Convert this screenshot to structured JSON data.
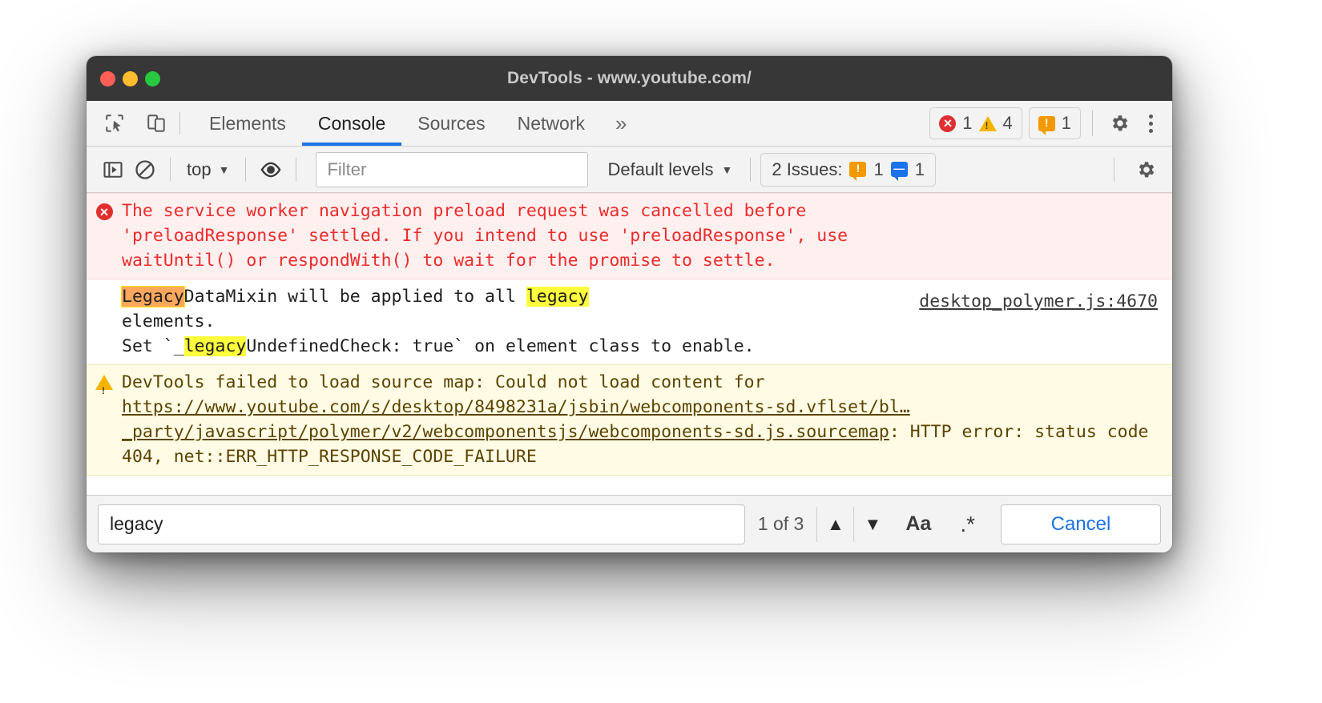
{
  "window": {
    "title": "DevTools - www.youtube.com/",
    "traffic_lights": [
      "close",
      "minimize",
      "maximize"
    ]
  },
  "tabstrip": {
    "inspect_icon": "inspect-element-icon",
    "device_icon": "device-toolbar-icon",
    "tabs": [
      {
        "label": "Elements",
        "active": false
      },
      {
        "label": "Console",
        "active": true
      },
      {
        "label": "Sources",
        "active": false
      },
      {
        "label": "Network",
        "active": false
      }
    ],
    "more_tabs": "»",
    "counters": {
      "error_count": "1",
      "warning_count": "4",
      "issue_count": "1"
    },
    "settings_icon": "gear-icon",
    "menu_icon": "kebab-menu-icon"
  },
  "console_toolbar": {
    "sidebar_icon": "console-sidebar-icon",
    "clear_icon": "clear-console-icon",
    "context": "top",
    "context_caret": "▼",
    "eye_icon": "live-expression-icon",
    "filter_placeholder": "Filter",
    "filter_value": "",
    "levels_label": "Default levels",
    "levels_caret": "▼",
    "issues_label": "2 Issues:",
    "issues_warning_count": "1",
    "issues_info_count": "1",
    "settings_icon": "console-settings-gear-icon"
  },
  "messages": [
    {
      "type": "error",
      "icon": "error-circle-icon",
      "lines": [
        "The service worker navigation preload request was cancelled before",
        "'preloadResponse' settled. If you intend to use 'preloadResponse', use",
        "waitUntil() or respondWith() to wait for the promise to settle."
      ]
    },
    {
      "type": "plain",
      "icon": "",
      "segments": [
        {
          "text": "Legacy",
          "highlight": "active"
        },
        {
          "text": "DataMixin will be applied to all ",
          "highlight": "none"
        },
        {
          "text": "legacy",
          "highlight": "yellow"
        },
        {
          "text": "\nelements.\nSet `_",
          "highlight": "none"
        },
        {
          "text": "legacy",
          "highlight": "yellow"
        },
        {
          "text": "UndefinedCheck: true` on element class to enable.",
          "highlight": "none"
        }
      ],
      "source_link": "desktop_polymer.js:4670"
    },
    {
      "type": "warn",
      "icon": "warning-triangle-icon",
      "segments": [
        {
          "text": "DevTools failed to load source map: Could not load content for ",
          "link": false
        },
        {
          "text": "https://www.youtube.com/s/desktop/8498231a/jsbin/webcomponents-sd.vflset/bl…_party/javascript/polymer/v2/webcomponentsjs/webcomponents-sd.js.sourcemap",
          "link": true
        },
        {
          "text": ": HTTP error: status code 404, net::ERR_HTTP_RESPONSE_CODE_FAILURE",
          "link": false
        }
      ]
    }
  ],
  "searchbar": {
    "query": "legacy",
    "matches": "1 of 3",
    "prev_icon": "chevron-up-icon",
    "next_icon": "chevron-down-icon",
    "match_case_label": "Aa",
    "regex_label": ".*",
    "cancel_label": "Cancel"
  },
  "colors": {
    "accent": "#1a73e8",
    "error_text": "#ee2b2b",
    "error_bg": "#fff0f0",
    "warn_bg": "#fffbe5",
    "warn_text": "#5c4400",
    "highlight_yellow": "#ffff3c",
    "highlight_active": "#ffa75c",
    "titlebar": "#373737"
  }
}
